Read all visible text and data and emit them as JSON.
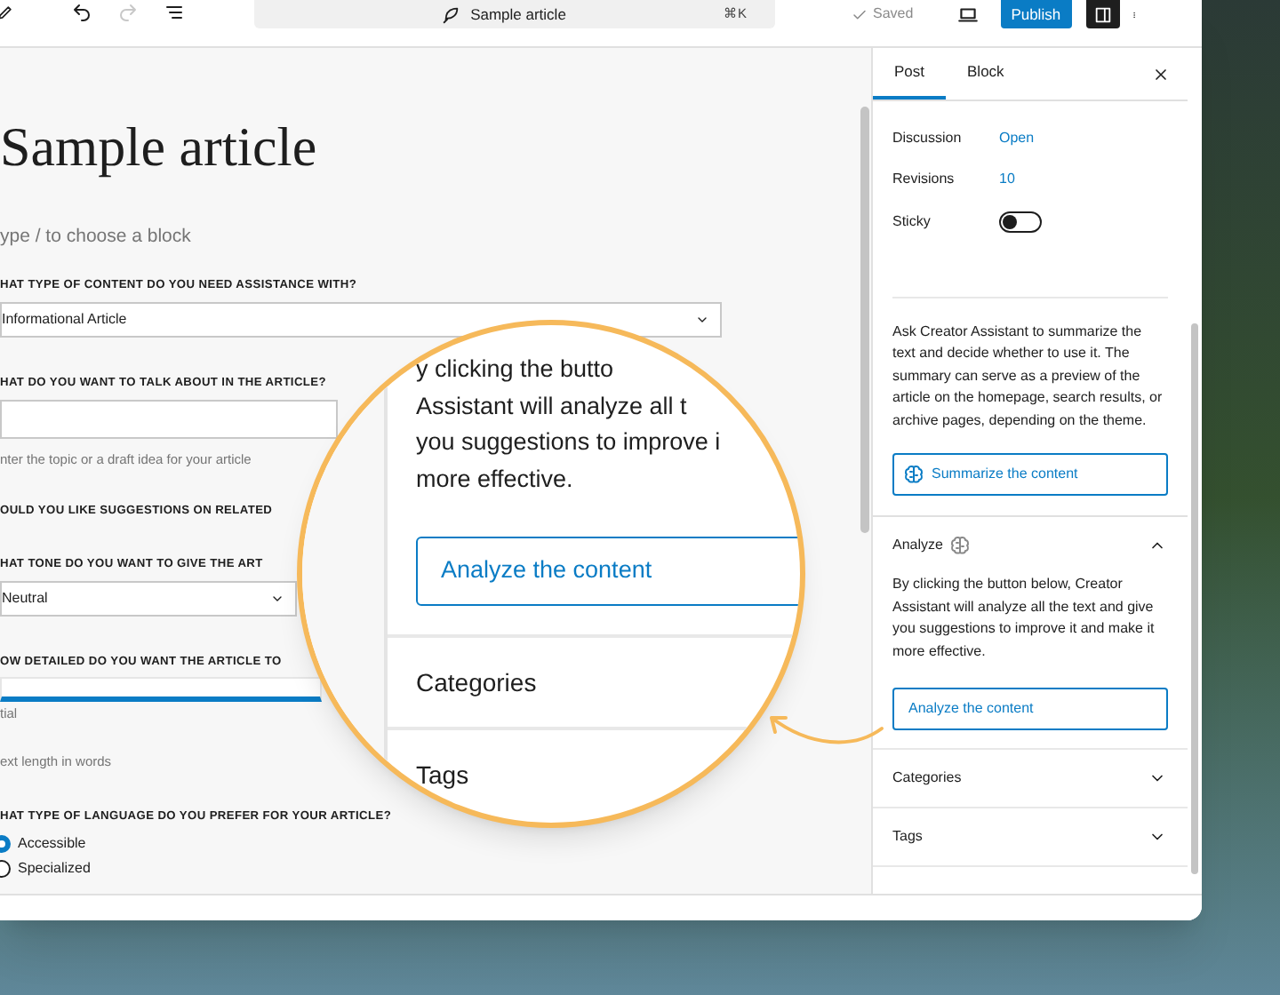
{
  "top_bar": {
    "command_title": "Sample article",
    "shortcut": "⌘K",
    "save_status": "Saved",
    "publish_label": "Publish",
    "redo_disabled": true
  },
  "editor": {
    "title": "Sample article",
    "block_hint": "ype / to choose a block",
    "fields": [
      {
        "kind": "select",
        "label": "HAT TYPE OF CONTENT DO YOU NEED ASSISTANCE WITH?",
        "value": "Informational Article"
      },
      {
        "kind": "text",
        "label": "HAT DO YOU WANT TO TALK ABOUT IN THE ARTICLE?",
        "focused": false,
        "notes": [
          "nter the topic or a draft idea for your article"
        ]
      },
      {
        "kind": "label",
        "label": "OULD YOU LIKE SUGGESTIONS ON RELATED"
      },
      {
        "kind": "select",
        "label": "HAT TONE DO YOU WANT TO GIVE THE ART",
        "value": "Neutral"
      },
      {
        "kind": "text",
        "label": "OW DETAILED DO YOU WANT THE ARTICLE TO",
        "focused": true,
        "notes": [
          "tial",
          "ext length in words"
        ]
      },
      {
        "kind": "radio",
        "label": "HAT TYPE OF LANGUAGE DO YOU PREFER FOR YOUR ARTICLE?",
        "options": [
          {
            "label": "Accessible",
            "selected": true
          },
          {
            "label": "Specialized",
            "selected": false
          }
        ]
      }
    ]
  },
  "sidebar": {
    "tabs": [
      {
        "label": "Post",
        "selected": true
      },
      {
        "label": "Block",
        "selected": false
      }
    ],
    "settings": [
      {
        "kind": "link",
        "label": "Discussion",
        "value": "Open"
      },
      {
        "kind": "link",
        "label": "Revisions",
        "value": "10"
      },
      {
        "kind": "toggle",
        "label": "Sticky",
        "on": false
      }
    ],
    "summary_text": "Ask Creator Assistant to summarize the text and decide whether to use it. The summary can serve as a preview of the article on the homepage, search results, or archive pages, depending on the theme.",
    "summary_button": "Summarize the content",
    "panels": [
      {
        "title": "Analyze",
        "expanded": true,
        "text": "By clicking the button below, Creator Assistant will analyze all the text and give you suggestions to improve it and make it more effective.",
        "button": "Analyze the content"
      },
      {
        "title": "Categories",
        "expanded": false
      },
      {
        "title": "Tags",
        "expanded": false
      }
    ]
  },
  "magnifier": {
    "lines": [
      "y clicking the butto",
      "Assistant will analyze all t",
      "you suggestions to improve i",
      "more effective."
    ],
    "button": "Analyze the content",
    "headings": [
      "Categories",
      "Tags"
    ]
  }
}
